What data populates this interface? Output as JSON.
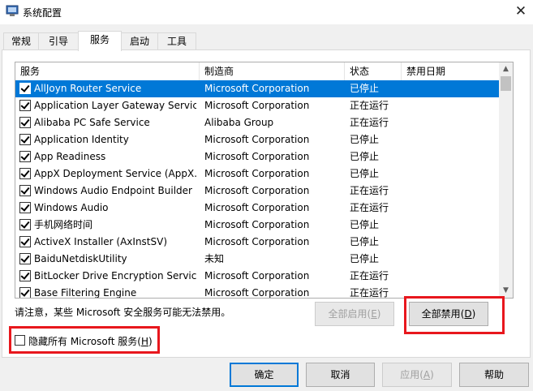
{
  "window": {
    "title": "系统配置",
    "close_glyph": "✕"
  },
  "tabs": [
    "常规",
    "引导",
    "服务",
    "启动",
    "工具"
  ],
  "columns": [
    "服务",
    "制造商",
    "状态",
    "禁用日期"
  ],
  "services": [
    {
      "name": "AllJoyn Router Service",
      "vendor": "Microsoft Corporation",
      "status": "已停止",
      "date": ""
    },
    {
      "name": "Application Layer Gateway Service",
      "vendor": "Microsoft Corporation",
      "status": "正在运行",
      "date": ""
    },
    {
      "name": "Alibaba PC Safe Service",
      "vendor": "Alibaba Group",
      "status": "正在运行",
      "date": ""
    },
    {
      "name": "Application Identity",
      "vendor": "Microsoft Corporation",
      "status": "已停止",
      "date": ""
    },
    {
      "name": "App Readiness",
      "vendor": "Microsoft Corporation",
      "status": "已停止",
      "date": ""
    },
    {
      "name": "AppX Deployment Service (AppX...",
      "vendor": "Microsoft Corporation",
      "status": "已停止",
      "date": ""
    },
    {
      "name": "Windows Audio Endpoint Builder",
      "vendor": "Microsoft Corporation",
      "status": "正在运行",
      "date": ""
    },
    {
      "name": "Windows Audio",
      "vendor": "Microsoft Corporation",
      "status": "正在运行",
      "date": ""
    },
    {
      "name": "手机网络时间",
      "vendor": "Microsoft Corporation",
      "status": "已停止",
      "date": ""
    },
    {
      "name": "ActiveX Installer (AxInstSV)",
      "vendor": "Microsoft Corporation",
      "status": "已停止",
      "date": ""
    },
    {
      "name": "BaiduNetdiskUtility",
      "vendor": "未知",
      "status": "已停止",
      "date": ""
    },
    {
      "name": "BitLocker Drive Encryption Service",
      "vendor": "Microsoft Corporation",
      "status": "正在运行",
      "date": ""
    },
    {
      "name": "Base Filtering Engine",
      "vendor": "Microsoft Corporation",
      "status": "正在运行",
      "date": ""
    }
  ],
  "notice": "请注意，某些 Microsoft 安全服务可能无法禁用。",
  "buttons": {
    "enable_all": "全部启用",
    "enable_all_key": "E",
    "disable_all": "全部禁用",
    "disable_all_key": "D",
    "ok": "确定",
    "cancel": "取消",
    "apply": "应用",
    "apply_key": "A",
    "help": "帮助"
  },
  "hide_ms": {
    "label": "隐藏所有 Microsoft 服务",
    "key": "H"
  },
  "colors": {
    "selection": "#0078d7",
    "highlight": "#e8171d"
  }
}
